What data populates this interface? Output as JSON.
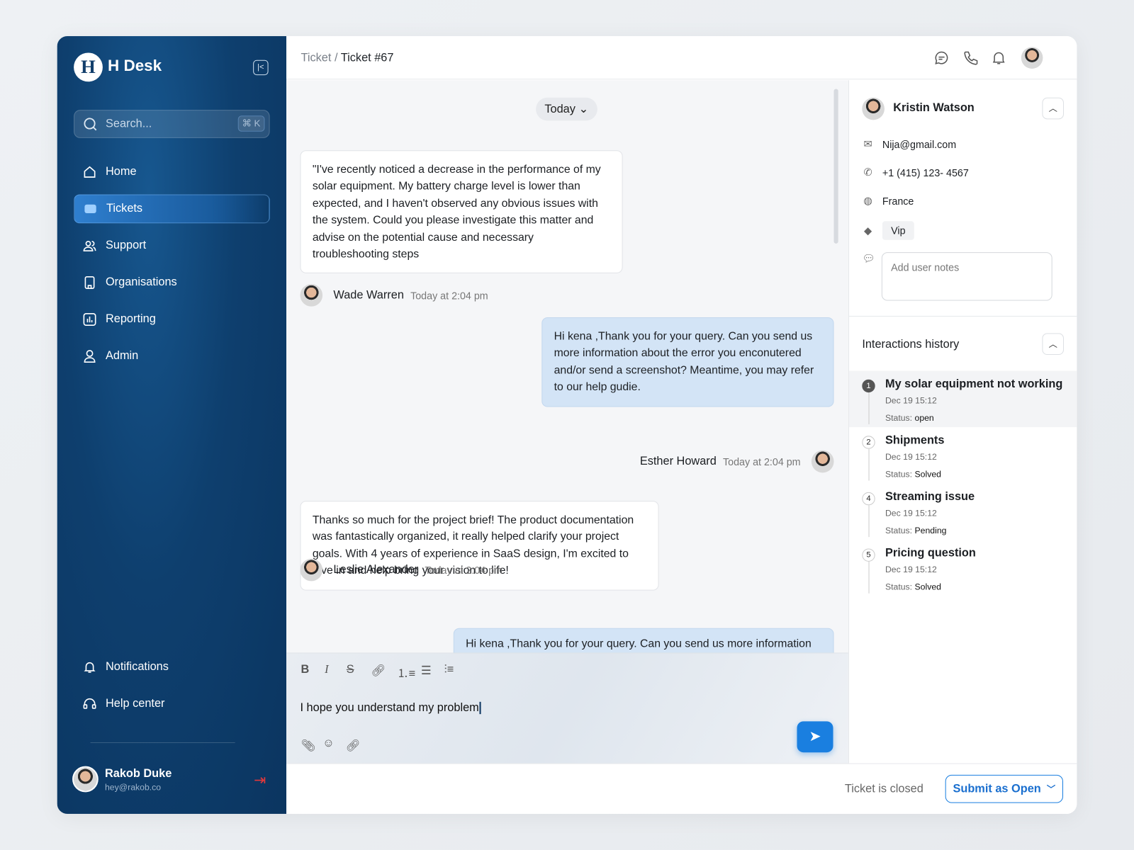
{
  "sidebar": {
    "logo_letter": "H",
    "brand": "H Desk",
    "collapse_icon": "collapse-icon",
    "search_placeholder": "Search...",
    "search_shortcut": "⌘ K",
    "items": [
      {
        "label": "Home",
        "icon": "home"
      },
      {
        "label": "Tickets",
        "icon": "ticket",
        "active": true
      },
      {
        "label": "Support",
        "icon": "users"
      },
      {
        "label": "Organisations",
        "icon": "building"
      },
      {
        "label": "Reporting",
        "icon": "chart"
      },
      {
        "label": "Admin",
        "icon": "user"
      }
    ],
    "bottom_items": [
      {
        "label": "Notifications",
        "icon": "bell"
      },
      {
        "label": "Help center",
        "icon": "headset"
      }
    ],
    "user": {
      "name": "Rakob Duke",
      "email": "hey@rakob.co"
    }
  },
  "header": {
    "breadcrumb": [
      "Ticket",
      "Ticket #67"
    ],
    "separator": "/"
  },
  "chat": {
    "date_filter": "Today",
    "messages": [
      {
        "text": "\"I've recently noticed a decrease in the performance of my solar equipment. My battery charge level is lower than expected, and I haven't observed any obvious issues with the system. Could you please investigate this matter and advise on the potential cause and necessary troubleshooting steps",
        "author": "Wade Warren",
        "time": "Today at 2:04 pm",
        "direction": "in"
      },
      {
        "text": "Hi kena ,Thank you  for your query. Can you send us more information about the error you enconutered and/or send  a screenshot? Meantime, you may refer to our help gudie.",
        "author": "Esther Howard",
        "time": "Today at 2:04 pm",
        "direction": "out"
      },
      {
        "text": "Thanks so much for the project brief! The product documentation was fantastically organized, it really helped clarify your project goals. With 4 years of experience in SaaS design, I'm excited to dive in and help bring your vision to life!",
        "author": "Leslie Alexander",
        "time": "Today at 2:04 pm",
        "direction": "in"
      },
      {
        "text": "Hi kena ,Thank you  for your query. Can you send us more information",
        "direction": "out"
      }
    ]
  },
  "composer": {
    "value": "I hope you understand my problem"
  },
  "customer": {
    "name": "Kristin Watson",
    "email": "Nija@gmail.com",
    "phone": "+1 (415) 123- 4567",
    "country": "France",
    "tag": "Vip",
    "notes_placeholder": "Add user notes"
  },
  "history": {
    "title": "Interactions history",
    "status_label": "Status:",
    "items": [
      {
        "num": "1",
        "title": "My solar equipment not working",
        "date": "Dec 19 15:12",
        "status": "open"
      },
      {
        "num": "2",
        "title": "Shipments",
        "date": "Dec 19 15:12",
        "status": "Solved"
      },
      {
        "num": "4",
        "title": "Streaming issue",
        "date": "Dec 19 15:12",
        "status": "Pending"
      },
      {
        "num": "5",
        "title": "Pricing question",
        "date": "Dec 19 15:12",
        "status": "Solved"
      }
    ]
  },
  "footer": {
    "status_text": "Ticket is closed",
    "submit_label": "Submit as Open"
  },
  "colors": {
    "sidebar": "#0e3f6e",
    "accent": "#1a7fe0",
    "outgoing_bubble": "#d3e4f6",
    "logout": "#e5383b"
  }
}
